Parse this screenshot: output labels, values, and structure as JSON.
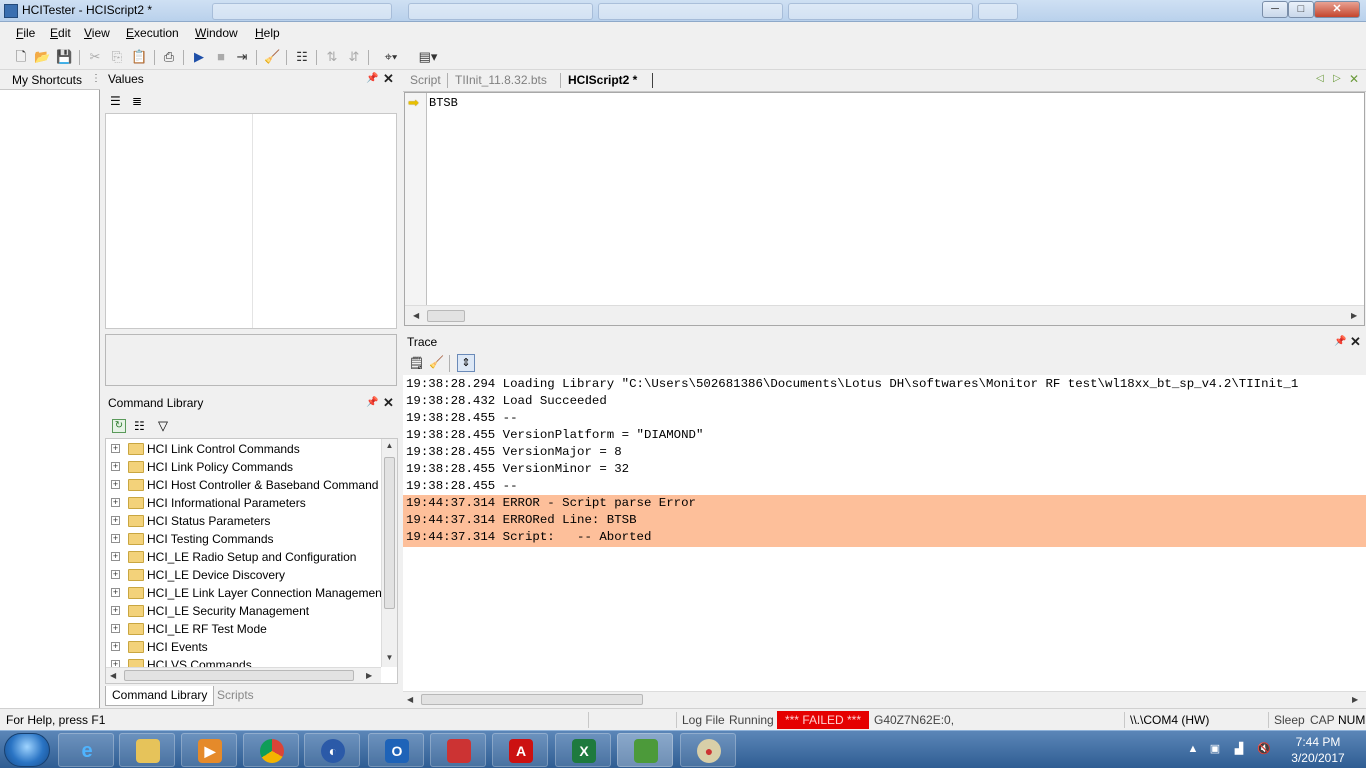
{
  "window": {
    "title": "HCITester - HCIScript2 *",
    "background_tabs": [
      "",
      "",
      "",
      "",
      "",
      ""
    ],
    "controls": {
      "minimize": "─",
      "maximize": "□",
      "close": "✕"
    }
  },
  "menu": [
    "File",
    "Edit",
    "View",
    "Execution",
    "Window",
    "Help"
  ],
  "toolbar": {
    "icons": [
      "new-file-icon",
      "open-folder-icon",
      "save-icon",
      "cut-icon",
      "copy-icon",
      "paste-icon",
      "print-icon",
      "run-icon",
      "stop-icon",
      "step-icon",
      "clear-icon",
      "properties-icon",
      "format-icon",
      "unformat-icon",
      "pointer-dropdown-icon",
      "layout-dropdown-icon"
    ]
  },
  "shortcuts": {
    "title": "My Shortcuts"
  },
  "values_panel": {
    "title": "Values"
  },
  "command_library": {
    "title": "Command Library",
    "items": [
      "HCI Link Control Commands",
      "HCI Link Policy Commands",
      "HCI Host Controller & Baseband Command",
      "HCI Informational Parameters",
      "HCI Status Parameters",
      "HCI Testing Commands",
      "HCI_LE Radio Setup and Configuration",
      "HCI_LE Device Discovery",
      "HCI_LE Link Layer Connection Management",
      "HCI_LE Security Management",
      "HCI_LE RF Test Mode",
      "HCI Events",
      "HCI VS Commands"
    ],
    "bottom_tabs": [
      "Command Library",
      "Scripts"
    ]
  },
  "editor": {
    "tabs": [
      "Script",
      "TIInit_11.8.32.bts",
      "HCIScript2 *"
    ],
    "active_tab": 2,
    "code": "BTSB"
  },
  "trace": {
    "title": "Trace",
    "lines": [
      {
        "text": "19:38:28.294 Loading Library \"C:\\Users\\502681386\\Documents\\Lotus DH\\softwares\\Monitor RF test\\wl18xx_bt_sp_v4.2\\TIInit_1",
        "error": false
      },
      {
        "text": "19:38:28.432 Load Succeeded",
        "error": false
      },
      {
        "text": "19:38:28.455 --",
        "error": false
      },
      {
        "text": "19:38:28.455 VersionPlatform = \"DIAMOND\"",
        "error": false
      },
      {
        "text": "19:38:28.455 VersionMajor = 8",
        "error": false
      },
      {
        "text": "19:38:28.455 VersionMinor = 32",
        "error": false
      },
      {
        "text": "19:38:28.455 --",
        "error": false
      },
      {
        "text": "19:44:37.314 ERROR - Script parse Error",
        "error": true
      },
      {
        "text": "19:44:37.314 ERRORed Line: BTSB",
        "error": true
      },
      {
        "text": "19:44:37.314 Script:   -- Aborted",
        "error": true
      }
    ]
  },
  "status": {
    "help": "For Help, press F1",
    "log_file": "Log File",
    "running": "Running",
    "failed": "*** FAILED ***",
    "device": "G40Z7N62E:0,",
    "port": "\\\\.\\COM4 (HW)",
    "sleep": "Sleep",
    "cap": "CAP",
    "num": "NUM"
  },
  "taskbar": {
    "apps": [
      "internet-explorer-icon",
      "file-explorer-icon",
      "media-player-icon",
      "chrome-icon",
      "remote-assist-icon",
      "outlook-icon",
      "toolbox-icon",
      "acrobat-icon",
      "excel-icon",
      "package-icon",
      "paint-icon"
    ],
    "time": "7:44 PM",
    "date": "3/20/2017"
  },
  "colors": {
    "error_highlight": "#fdbf9a",
    "failed_badge": "#e50000"
  }
}
